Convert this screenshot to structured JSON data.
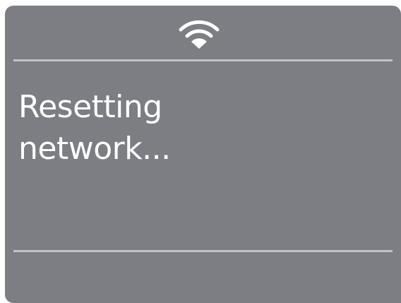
{
  "status_icon": "wifi-icon",
  "message": {
    "line1": "Resetting",
    "line2": "network..."
  },
  "colors": {
    "panel_background": "#7d7e83",
    "divider": "#c2c3c6",
    "text": "#ffffff"
  }
}
